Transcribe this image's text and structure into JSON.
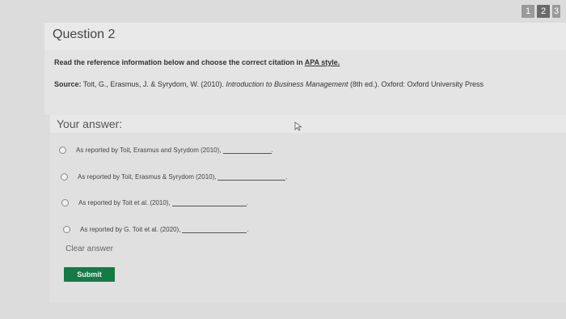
{
  "pagination": {
    "pages": [
      "1",
      "2",
      "3"
    ],
    "current": "2"
  },
  "question": {
    "title": "Question 2",
    "instruction_prefix": "Read the reference information below and choose the correct citation in ",
    "instruction_link": "APA style.",
    "source_label": "Source:",
    "source_authors": " Toit, G., Erasmus, J. & Syrydom, W. (2010). ",
    "source_title": "Introduction to Business Management",
    "source_rest": " (8th ed.). Oxford: Oxford University Press"
  },
  "answer": {
    "label": "Your answer:",
    "options": [
      {
        "text": "As reported by Toit, Erasmus and Syrydom (2010),",
        "end": "."
      },
      {
        "text": "As reported by Toit, Erasmus & Syrydom (2010),",
        "end": "."
      },
      {
        "text": "As reported by Toit et al. (2010),",
        "end": "."
      },
      {
        "text": "As reported by G. Toit et al. (2020),",
        "end": "."
      }
    ],
    "clear_label": "Clear answer",
    "submit_label": "Submit"
  },
  "colors": {
    "submit_bg": "#157a45",
    "background": "#dcdcdc"
  },
  "icons": {
    "cursor": "mouse-pointer-icon",
    "radio": "radio-circle-icon"
  }
}
